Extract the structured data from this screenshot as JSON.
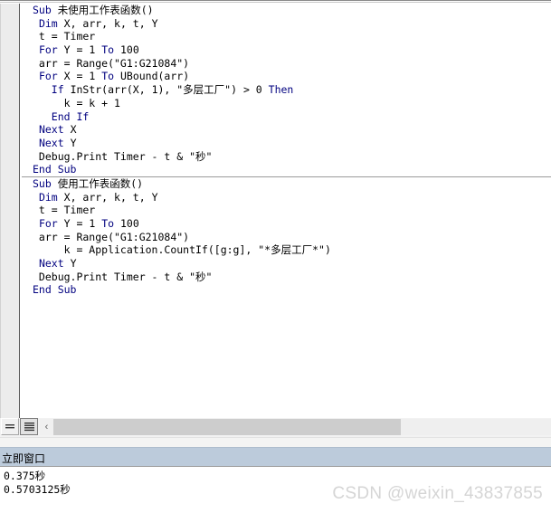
{
  "code_window": {
    "name": "code-editor",
    "margin_bar_present": true,
    "procedures": [
      {
        "name": "未使用工作表函数",
        "lines": [
          [
            {
              "t": "Sub ",
              "c": "kw"
            },
            {
              "t": "未使用工作表函数()",
              "c": "plain"
            }
          ],
          [
            {
              "t": " ",
              "c": "plain"
            },
            {
              "t": "Dim ",
              "c": "kw"
            },
            {
              "t": "X, arr, k, t, Y",
              "c": "plain"
            }
          ],
          [
            {
              "t": " t = Timer",
              "c": "plain"
            }
          ],
          [
            {
              "t": " ",
              "c": "plain"
            },
            {
              "t": "For ",
              "c": "kw"
            },
            {
              "t": "Y = 1 ",
              "c": "plain"
            },
            {
              "t": "To ",
              "c": "kw"
            },
            {
              "t": "100",
              "c": "plain"
            }
          ],
          [
            {
              "t": " arr = Range(\"G1:G21084\")",
              "c": "plain"
            }
          ],
          [
            {
              "t": " ",
              "c": "plain"
            },
            {
              "t": "For ",
              "c": "kw"
            },
            {
              "t": "X = 1 ",
              "c": "plain"
            },
            {
              "t": "To ",
              "c": "kw"
            },
            {
              "t": "UBound(arr)",
              "c": "plain"
            }
          ],
          [
            {
              "t": "   ",
              "c": "plain"
            },
            {
              "t": "If ",
              "c": "kw"
            },
            {
              "t": "InStr(arr(X, 1), \"多层工厂\") > 0 ",
              "c": "plain"
            },
            {
              "t": "Then",
              "c": "kw"
            }
          ],
          [
            {
              "t": "     k = k + 1",
              "c": "plain"
            }
          ],
          [
            {
              "t": "   ",
              "c": "plain"
            },
            {
              "t": "End If",
              "c": "kw"
            }
          ],
          [
            {
              "t": " ",
              "c": "plain"
            },
            {
              "t": "Next ",
              "c": "kw"
            },
            {
              "t": "X",
              "c": "plain"
            }
          ],
          [
            {
              "t": " ",
              "c": "plain"
            },
            {
              "t": "Next ",
              "c": "kw"
            },
            {
              "t": "Y",
              "c": "plain"
            }
          ],
          [
            {
              "t": " Debug.Print Timer - t & \"秒\"",
              "c": "plain"
            }
          ],
          [
            {
              "t": "End Sub",
              "c": "kw"
            }
          ]
        ]
      },
      {
        "name": "使用工作表函数",
        "lines": [
          [
            {
              "t": "Sub ",
              "c": "kw"
            },
            {
              "t": "使用工作表函数()",
              "c": "plain"
            }
          ],
          [
            {
              "t": " ",
              "c": "plain"
            },
            {
              "t": "Dim ",
              "c": "kw"
            },
            {
              "t": "X, arr, k, t, Y",
              "c": "plain"
            }
          ],
          [
            {
              "t": " t = Timer",
              "c": "plain"
            }
          ],
          [
            {
              "t": " ",
              "c": "plain"
            },
            {
              "t": "For ",
              "c": "kw"
            },
            {
              "t": "Y = 1 ",
              "c": "plain"
            },
            {
              "t": "To ",
              "c": "kw"
            },
            {
              "t": "100",
              "c": "plain"
            }
          ],
          [
            {
              "t": " arr = Range(\"G1:G21084\")",
              "c": "plain"
            }
          ],
          [
            {
              "t": "     k = Application.CountIf([g:g], \"*多层工厂*\")",
              "c": "plain"
            }
          ],
          [
            {
              "t": " ",
              "c": "plain"
            },
            {
              "t": "Next ",
              "c": "kw"
            },
            {
              "t": "Y",
              "c": "plain"
            }
          ],
          [
            {
              "t": " Debug.Print Timer - t & \"秒\"",
              "c": "plain"
            }
          ],
          [
            {
              "t": "End Sub",
              "c": "kw"
            }
          ]
        ]
      }
    ]
  },
  "view_toggle": {
    "procedure_view_icon": "procedure-view-icon",
    "full_module_view_icon": "full-module-view-icon"
  },
  "hscrollbar": {
    "left_arrow_glyph": "‹"
  },
  "immediate_window": {
    "title": "立即窗口",
    "output_lines": [
      "0.375秒",
      "0.5703125秒"
    ]
  },
  "watermark": {
    "text": "CSDN @weixin_43837855"
  },
  "colors": {
    "keyword": "#00007f",
    "code_background": "#ffffff",
    "margin_bar": "#ececec",
    "immediate_titlebar": "#bccbdb",
    "scrollbar_thumb": "#cdcdcd",
    "watermark": "#d5d5d5"
  }
}
